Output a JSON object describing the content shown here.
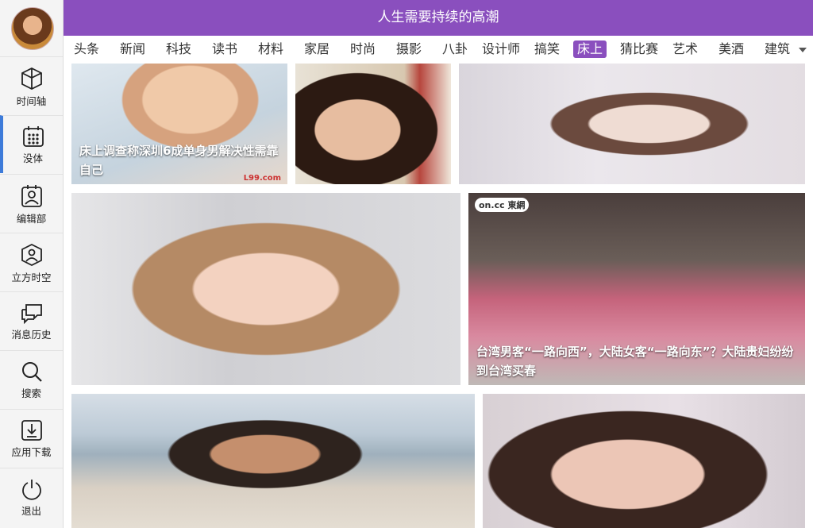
{
  "header": {
    "title": "人生需要持续的高潮"
  },
  "sidebar": {
    "items": [
      {
        "label": "时间轴"
      },
      {
        "label": "没体"
      },
      {
        "label": "编辑部"
      },
      {
        "label": "立方时空"
      },
      {
        "label": "消息历史"
      },
      {
        "label": "搜索"
      },
      {
        "label": "应用下载"
      },
      {
        "label": "退出"
      }
    ]
  },
  "tabs": [
    "头条",
    "新闻",
    "科技",
    "读书",
    "材料",
    "家居",
    "时尚",
    "摄影",
    "八卦",
    "设计师",
    "搞笑",
    "床上",
    "猜比赛",
    "艺术",
    "美酒",
    "建筑"
  ],
  "active_tab": "床上",
  "cards": [
    {
      "caption": "床上调查称深圳6成单身男解决性需靠自己",
      "watermark": "L99.com"
    },
    {
      "caption": ""
    },
    {
      "caption": ""
    },
    {
      "caption": ""
    },
    {
      "caption": "台湾男客“一路向西”，大陆女客“一路向东”？大陆贵妇纷纷到台湾买春",
      "logo": "on.cc 東網"
    },
    {
      "caption": ""
    },
    {
      "caption": ""
    }
  ],
  "colors": {
    "accent": "#8a4fbe",
    "active_indicator": "#3d7bd9"
  }
}
